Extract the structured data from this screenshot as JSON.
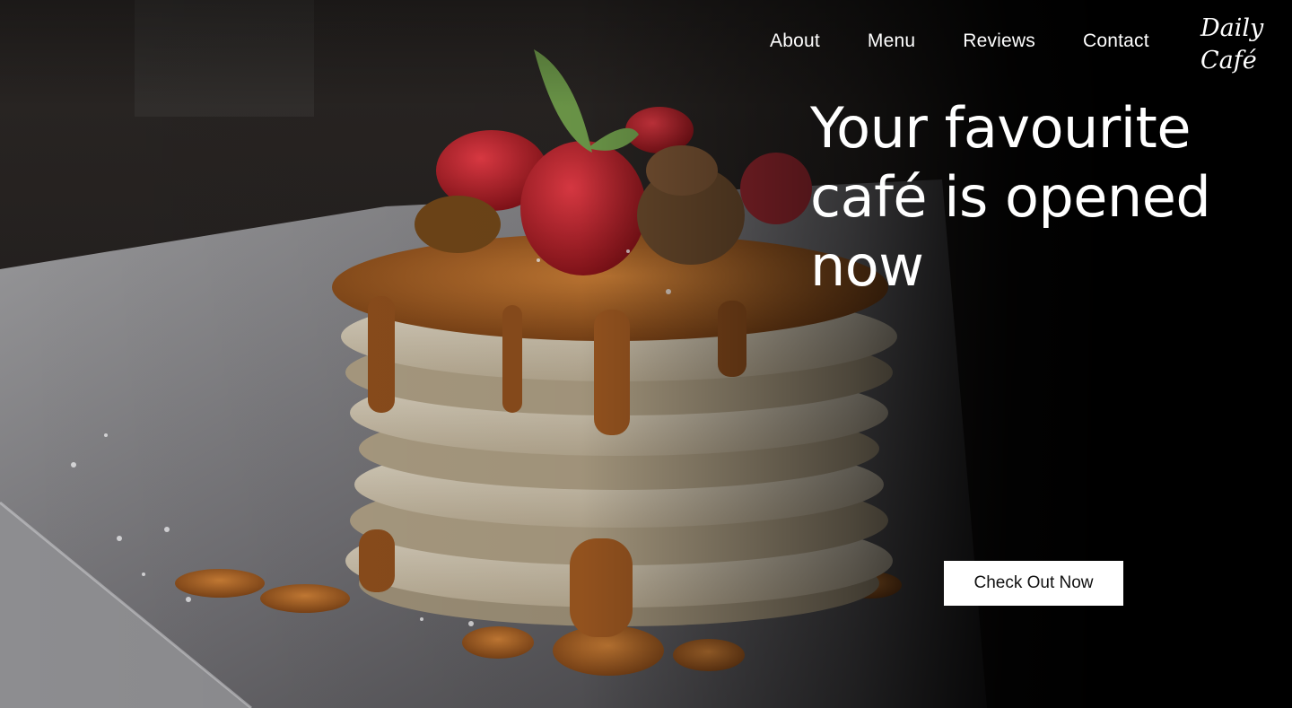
{
  "nav": {
    "items": [
      {
        "label": "About"
      },
      {
        "label": "Menu"
      },
      {
        "label": "Reviews"
      },
      {
        "label": "Contact"
      }
    ]
  },
  "logo": {
    "line1": "Daily",
    "line2": "Café",
    "text": "Daily Café"
  },
  "hero": {
    "headline": "Your favourite café is opened now",
    "cta_label": "Check Out Now",
    "background_image": "stack of pancakes with caramel sauce, strawberries and mint on a white plate"
  },
  "colors": {
    "background": "#000000",
    "text": "#ffffff",
    "button_bg": "#ffffff",
    "button_text": "#111111",
    "caramel": "#a8642a",
    "strawberry": "#b8202a"
  }
}
